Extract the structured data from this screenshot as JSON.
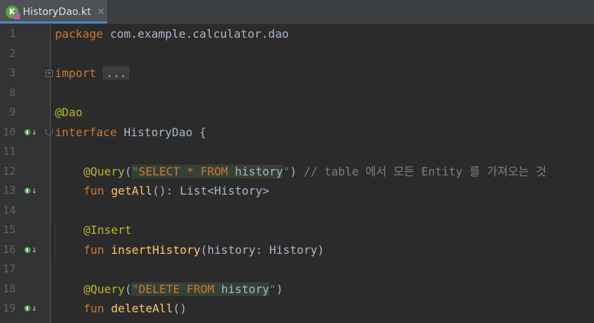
{
  "tab": {
    "filename": "HistoryDao.kt",
    "close": "✕"
  },
  "colors": {
    "background": "#2b2b2b",
    "gutter": "#313335",
    "keyword": "#cc7832",
    "annotation": "#bbb529",
    "string": "#6a8759",
    "function": "#ffc66d",
    "comment": "#808080",
    "identifier": "#a9b7c6",
    "line_number": "#606366"
  },
  "gutter_icons": "implementation-marker-icon",
  "code": {
    "l1": {
      "num": "1",
      "kw": "package",
      "rest": " com.example.calculator.dao"
    },
    "l2": {
      "num": "2"
    },
    "l3": {
      "num": "3",
      "kw": "import",
      "folded": "..."
    },
    "l8": {
      "num": "8"
    },
    "l9": {
      "num": "9",
      "ann": "@Dao"
    },
    "l10": {
      "num": "10",
      "kw": "interface",
      "rest": " HistoryDao {"
    },
    "l11": {
      "num": "11"
    },
    "l12": {
      "num": "12",
      "ann": "@Query",
      "p1": "(",
      "q1": "\"",
      "sql_kw1": "SELECT * FROM",
      "sql_sp": " ",
      "sql_tbl": "history",
      "q2": "\"",
      "p2": ")",
      "comment": " // table 에서 모든 Entity 를 가져오는 것"
    },
    "l13": {
      "num": "13",
      "kw": "fun",
      "fn": "getAll",
      "rest": "(): List<History>"
    },
    "l14": {
      "num": "14"
    },
    "l15": {
      "num": "15",
      "ann": "@Insert"
    },
    "l16": {
      "num": "16",
      "kw": "fun",
      "fn": "insertHistory",
      "rest": "(history: History)"
    },
    "l17": {
      "num": "17"
    },
    "l18": {
      "num": "18",
      "ann": "@Query",
      "p1": "(",
      "q1": "\"",
      "sql_kw1": "DELETE FROM",
      "sql_sp": " ",
      "sql_tbl": "history",
      "q2": "\"",
      "p2": ")"
    },
    "l19": {
      "num": "19",
      "kw": "fun",
      "fn": "deleteAll",
      "rest": "()"
    }
  }
}
